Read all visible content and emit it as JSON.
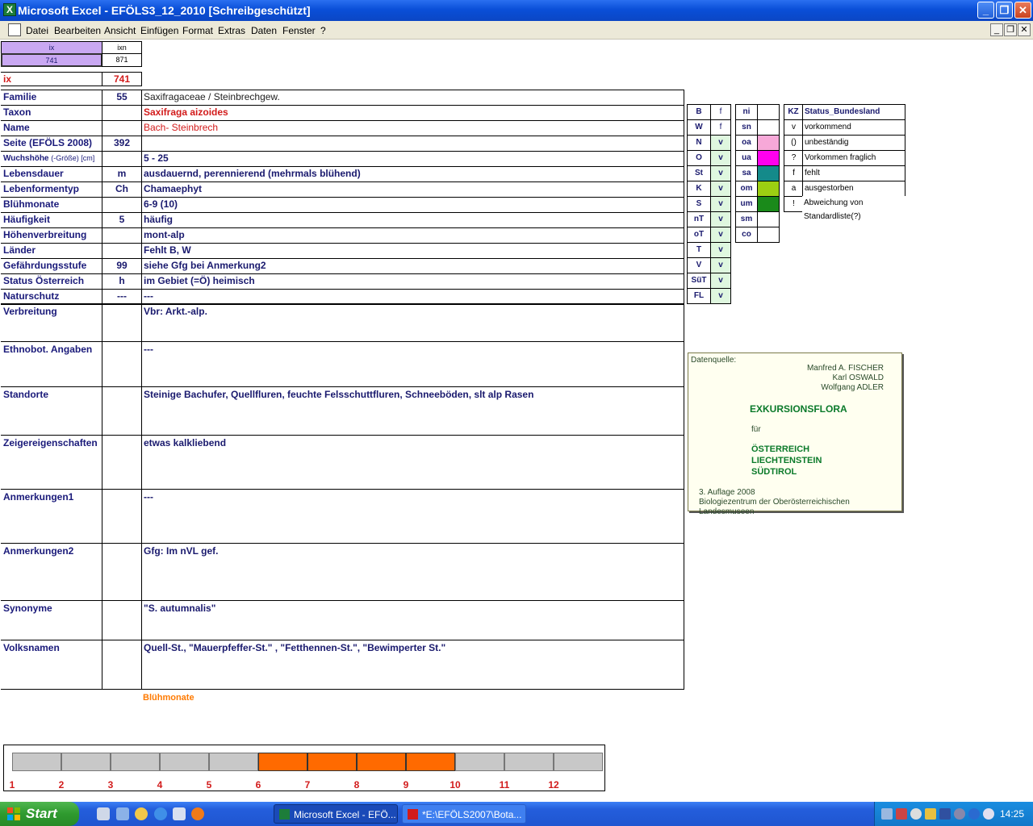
{
  "window": {
    "title": "Microsoft Excel - EFÖLS3_12_2010  [Schreibgeschützt]",
    "buttons": {
      "minimize": "_",
      "restore": "❐",
      "close": "✕"
    }
  },
  "menu": {
    "items": [
      "Datei",
      "Bearbeiten",
      "Ansicht",
      "Einfügen",
      "Format",
      "Extras",
      "Daten",
      "Fenster",
      "?"
    ]
  },
  "index": {
    "head_ix": "ix",
    "head_ixn": "ixn",
    "ix_value": "741",
    "ixn_value": "871",
    "ix_label": "ix",
    "ix_big": "741"
  },
  "rows": [
    {
      "label": "Familie",
      "code": "55",
      "value": "Saxifragaceae  /  Steinbrechgew."
    },
    {
      "label": "Taxon",
      "code": "",
      "value": "Saxifraga aizoides"
    },
    {
      "label": "Name",
      "code": "",
      "value": "Bach- Steinbrech"
    },
    {
      "label": "Seite (EFÖLS 2008)",
      "code": "392",
      "value": ""
    },
    {
      "label": "Wuchshöhe",
      "label_suffix": "(-Größe) [cm]",
      "code": "",
      "value": " 5 - 25"
    },
    {
      "label": "Lebensdauer",
      "code": "m",
      "value": "ausdauernd, perennierend (mehrmals blühend)"
    },
    {
      "label": "Lebenformentyp",
      "code": "Ch",
      "value": "Chamaephyt"
    },
    {
      "label": "Blühmonate",
      "code": "",
      "value": " 6-9 (10)"
    },
    {
      "label": "Häufigkeit",
      "code": "5",
      "value": "häufig"
    },
    {
      "label": "Höhenverbreitung",
      "code": "",
      "value": "mont-alp"
    },
    {
      "label": "Länder",
      "code": "",
      "value": "Fehlt B, W"
    },
    {
      "label": "Gefährdungsstufe",
      "code": "99",
      "value": "siehe Gfg bei Anmerkung2"
    },
    {
      "label": "Status Österreich",
      "code": "h",
      "value": "im Gebiet (=Ö) heimisch"
    },
    {
      "label": "Naturschutz",
      "code": "---",
      "value": " ---"
    }
  ],
  "text_rows": [
    {
      "label": "Verbreitung",
      "value": "Vbr: Arkt.-alp."
    },
    {
      "label": "Ethnobot. Angaben",
      "value": "---"
    },
    {
      "label": "Standorte",
      "value": "Steinige Bachufer, Quellfluren, feuchte Felsschuttfluren, Schneeböden, slt alp Rasen"
    },
    {
      "label": "Zeigereigenschaften",
      "value": "etwas kalkliebend"
    },
    {
      "label": "Anmerkungen1",
      "value": "---"
    },
    {
      "label": "Anmerkungen2",
      "value": "Gfg: Im nVL gef."
    },
    {
      "label": "Synonyme",
      "value": "\"S. autumnalis\""
    },
    {
      "label": "Volksnamen",
      "value": "Quell-St., \"Mauerpfeffer-St.\" ,   \"Fetthennen-St.\", \"Bewimperter St.\""
    }
  ],
  "legend_states": {
    "header": [
      "B",
      "f"
    ],
    "rows": [
      [
        "W",
        "f"
      ],
      [
        "N",
        "v"
      ],
      [
        "O",
        "v"
      ],
      [
        "St",
        "v"
      ],
      [
        "K",
        "v"
      ],
      [
        "S",
        "v"
      ],
      [
        "nT",
        "v"
      ],
      [
        "oT",
        "v"
      ],
      [
        "T",
        "v"
      ],
      [
        "V",
        "v"
      ],
      [
        "SüT",
        "v"
      ],
      [
        "FL",
        "v"
      ]
    ]
  },
  "legend_regions": {
    "header": "ni",
    "rows": [
      {
        "code": "sn",
        "color": ""
      },
      {
        "code": "oa",
        "color": "#f7a8d8"
      },
      {
        "code": "ua",
        "color": "#ff00ee"
      },
      {
        "code": "sa",
        "color": "#148a8a"
      },
      {
        "code": "om",
        "color": "#9ccf12"
      },
      {
        "code": "um",
        "color": "#1a8a1a"
      },
      {
        "code": "sm",
        "color": ""
      },
      {
        "code": "co",
        "color": ""
      }
    ]
  },
  "legend_status": {
    "head_kz": "KZ",
    "head_status": "Status_Bundesland",
    "rows": [
      {
        "kz": "v",
        "text": "vorkommend"
      },
      {
        "kz": "()",
        "text": "unbeständig"
      },
      {
        "kz": "?",
        "text": "Vorkommen fraglich"
      },
      {
        "kz": "f",
        "text": "fehlt"
      },
      {
        "kz": "a",
        "text": "ausgestorben"
      },
      {
        "kz": "!",
        "text": "Abweichung von Standardliste(?)"
      }
    ]
  },
  "source": {
    "label": "Datenquelle:",
    "authors": [
      "Manfred A. FISCHER",
      "Karl OSWALD",
      "Wolfgang ADLER"
    ],
    "book": "EXKURSIONSFLORA",
    "fuer": "für",
    "countries": [
      "ÖSTERREICH",
      "LIECHTENSTEIN",
      "SÜDTIROL"
    ],
    "edition": "3. Auflage 2008",
    "publisher": "Biologiezentrum der Oberösterreichischen Landesmuseen"
  },
  "chart_data": {
    "type": "bar",
    "title": "Blühmonate",
    "categories": [
      "1",
      "2",
      "3",
      "4",
      "5",
      "6",
      "7",
      "8",
      "9",
      "10",
      "11",
      "12"
    ],
    "values": [
      0,
      0,
      0,
      0,
      0,
      1,
      1,
      1,
      1,
      0,
      0,
      0
    ],
    "colors": {
      "active": "#ff6a00",
      "inactive": "#c8c8c8"
    }
  },
  "taskbar": {
    "start": "Start",
    "tasks": [
      "Microsoft Excel - EFÖ...",
      "*E:\\EFÖLS2007\\Bota..."
    ],
    "time": "14:25"
  }
}
